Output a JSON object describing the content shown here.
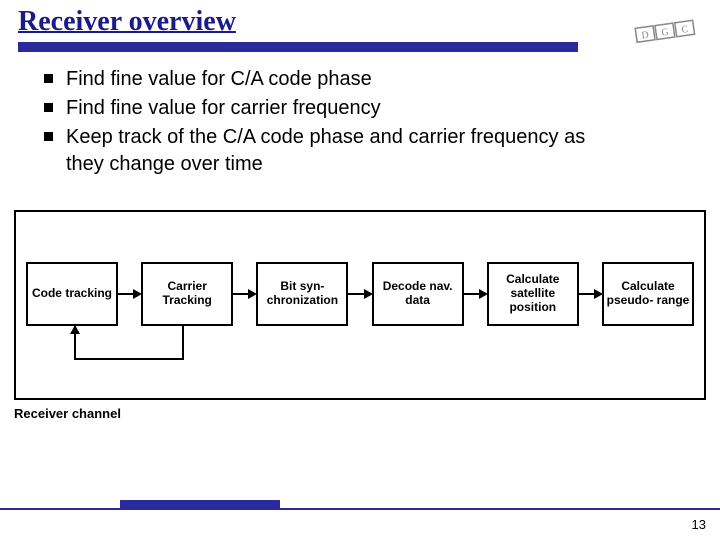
{
  "title": "Receiver overview",
  "bullets": [
    "Find fine value for C/A code phase",
    "Find fine value for carrier frequency",
    "Keep track of the C/A code phase and carrier frequency as they change over time"
  ],
  "flow_boxes": [
    "Code tracking",
    "Carrier Tracking",
    "Bit syn- chronization",
    "Decode nav. data",
    "Calculate satellite position",
    "Calculate pseudo- range"
  ],
  "channel_label": "Receiver channel",
  "page_number": "13"
}
